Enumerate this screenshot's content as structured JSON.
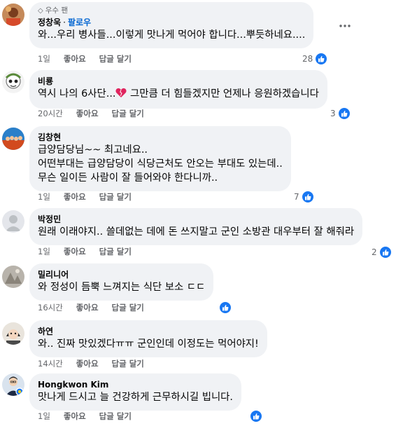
{
  "comments": [
    {
      "badge": "우수 팬",
      "name": "정창욱",
      "follow": "팔로우",
      "text": "와...우리 병사들...이렇게 맛나게 먹어야 합니다...뿌듯하네요....",
      "time": "1일",
      "like": "좋아요",
      "reply": "답글 달기",
      "reactions": "28"
    },
    {
      "name": "비룡",
      "text_before": "역시 나의 6사단...",
      "text_after": " 그만큼 더 힘들겠지만 언제나 응원하겠습니다",
      "time": "20시간",
      "like": "좋아요",
      "reply": "답글 달기",
      "reactions": "3"
    },
    {
      "name": "김창현",
      "lines": [
        "급양담당님~~ 최고네요..",
        "어떤부대는 급양담당이 식당근처도 안오는 부대도 있는데..",
        "무슨 일이든 사람이 잘 들어와야 한다니까.."
      ],
      "time": "1일",
      "like": "좋아요",
      "reply": "답글 달기",
      "reactions": "7"
    },
    {
      "name": "박정민",
      "text": "원래 이래야지.. 쓸데없는 데에 돈 쓰지말고 군인 소방관 대우부터 잘 해줘라",
      "time": "1일",
      "like": "좋아요",
      "reply": "답글 달기",
      "reactions": "2"
    },
    {
      "name": "밀리니어",
      "text": "와 정성이 듬뿍 느껴지는 식단 보소 ㄷㄷ",
      "time": "16시간",
      "like": "좋아요",
      "reply": "답글 달기",
      "reactions": ""
    },
    {
      "name": "하연",
      "text": "와.. 진짜 맛있겠다ㅠㅠ 군인인데 이정도는 먹어야지!",
      "time": "14시간",
      "like": "좋아요",
      "reply": "답글 달기",
      "reactions": ""
    },
    {
      "name": "Hongkwon Kim",
      "text": "맛나게 드시고 늘 건강하게 근무하시길 빕니다.",
      "time": "1일",
      "like": "좋아요",
      "reply": "답글 달기",
      "reactions": ""
    }
  ],
  "icons": {
    "more": "more-horizontal-icon",
    "like": "like-thumb-icon",
    "heart": "broken-heart-emoji",
    "badge": "diamond-icon"
  },
  "colors": {
    "bubble": "#f0f2f5",
    "like_blue": "#1877f2",
    "follow_blue": "#0064d1",
    "meta_gray": "#65676b",
    "heart_red": "#e0245e"
  }
}
